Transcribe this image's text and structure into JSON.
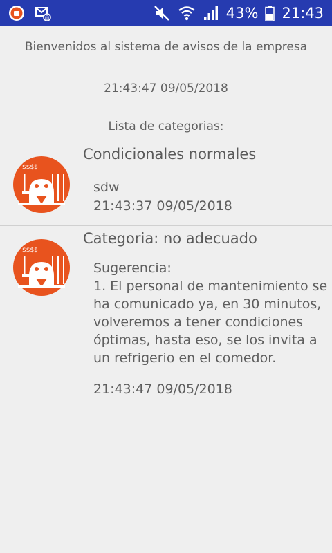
{
  "status_bar": {
    "battery": "43%",
    "time": "21:43",
    "bg_color": "#263bb0",
    "icons": [
      "app-notification-icon",
      "email-notification-icon",
      "mute-icon",
      "wifi-icon",
      "signal-icon",
      "battery-icon"
    ]
  },
  "main": {
    "welcome": "Bienvenidos al sistema de avisos de la empresa",
    "datetime": "21:43:47 09/05/2018",
    "list_title": "Lista de categorias:"
  },
  "items": [
    {
      "title": "Condicionales normales",
      "body": "sdw",
      "time": "21:43:37 09/05/2018",
      "icon": "factory-robot-icon"
    },
    {
      "title": "Categoria: no adecuado",
      "body": "Sugerencia:\n 1. El personal de mantenimiento se ha comunicado ya, en 30 minutos, volveremos a tener condiciones óptimas, hasta eso, se los invita a un refrigerio en el comedor.",
      "time": "21:43:47 09/05/2018",
      "icon": "factory-robot-icon"
    }
  ],
  "colors": {
    "background": "#efefef",
    "avatar": "#e8531e",
    "text": "#616161"
  }
}
